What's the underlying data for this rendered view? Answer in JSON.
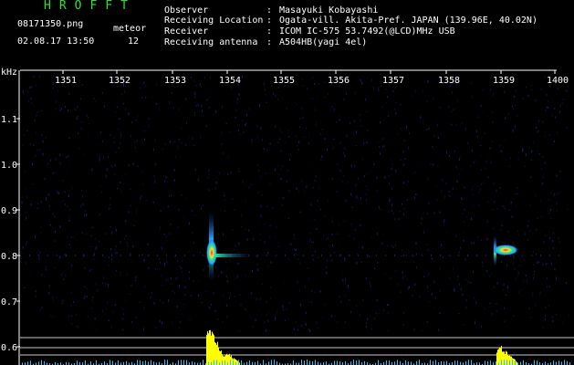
{
  "header": {
    "app_title": "HROFFT",
    "filename": "08171350.png",
    "datetime": "02.08.17 13:50",
    "mode_label": "meteor",
    "mode_count": "12"
  },
  "info": [
    {
      "label": "Observer",
      "value": "Masayuki Kobayashi"
    },
    {
      "label": "Receiving Location",
      "value": "Ogata-vill. Akita-Pref. JAPAN (139.96E, 40.02N)"
    },
    {
      "label": "Receiver",
      "value": "ICOM IC-575 53.7492(@LCD)MHz USB"
    },
    {
      "label": "Receiving antenna",
      "value": "A504HB(yagi 4el)"
    }
  ],
  "axes": {
    "y_unit": "kHz",
    "x_ticks": [
      "1351",
      "1352",
      "1353",
      "1354",
      "1355",
      "1356",
      "1357",
      "1358",
      "1359",
      "1400"
    ],
    "y_ticks": [
      "1.1",
      "1.0",
      "0.9",
      "0.8",
      "0.7",
      "0.6"
    ]
  },
  "colors": {
    "title": "#2fe02f",
    "noise_blue": "#1b2a9a",
    "hot": "#ff2060",
    "signal_green": "#20e0a0",
    "signal_cyan": "#20c8ff",
    "power_yellow": "#ffff00"
  },
  "chart_data": {
    "type": "heatmap",
    "x_unit": "time (HHMM)",
    "y_unit": "kHz",
    "ylim": [
      0.56,
      1.16
    ],
    "carrier_khz": 0.8,
    "events": [
      {
        "time": "1353.7",
        "freq_khz": 0.81,
        "kind": "meteor echo",
        "intensity": "strong"
      },
      {
        "time": "1358.9",
        "freq_khz": 0.81,
        "kind": "meteor echo",
        "intensity": "medium"
      }
    ]
  }
}
